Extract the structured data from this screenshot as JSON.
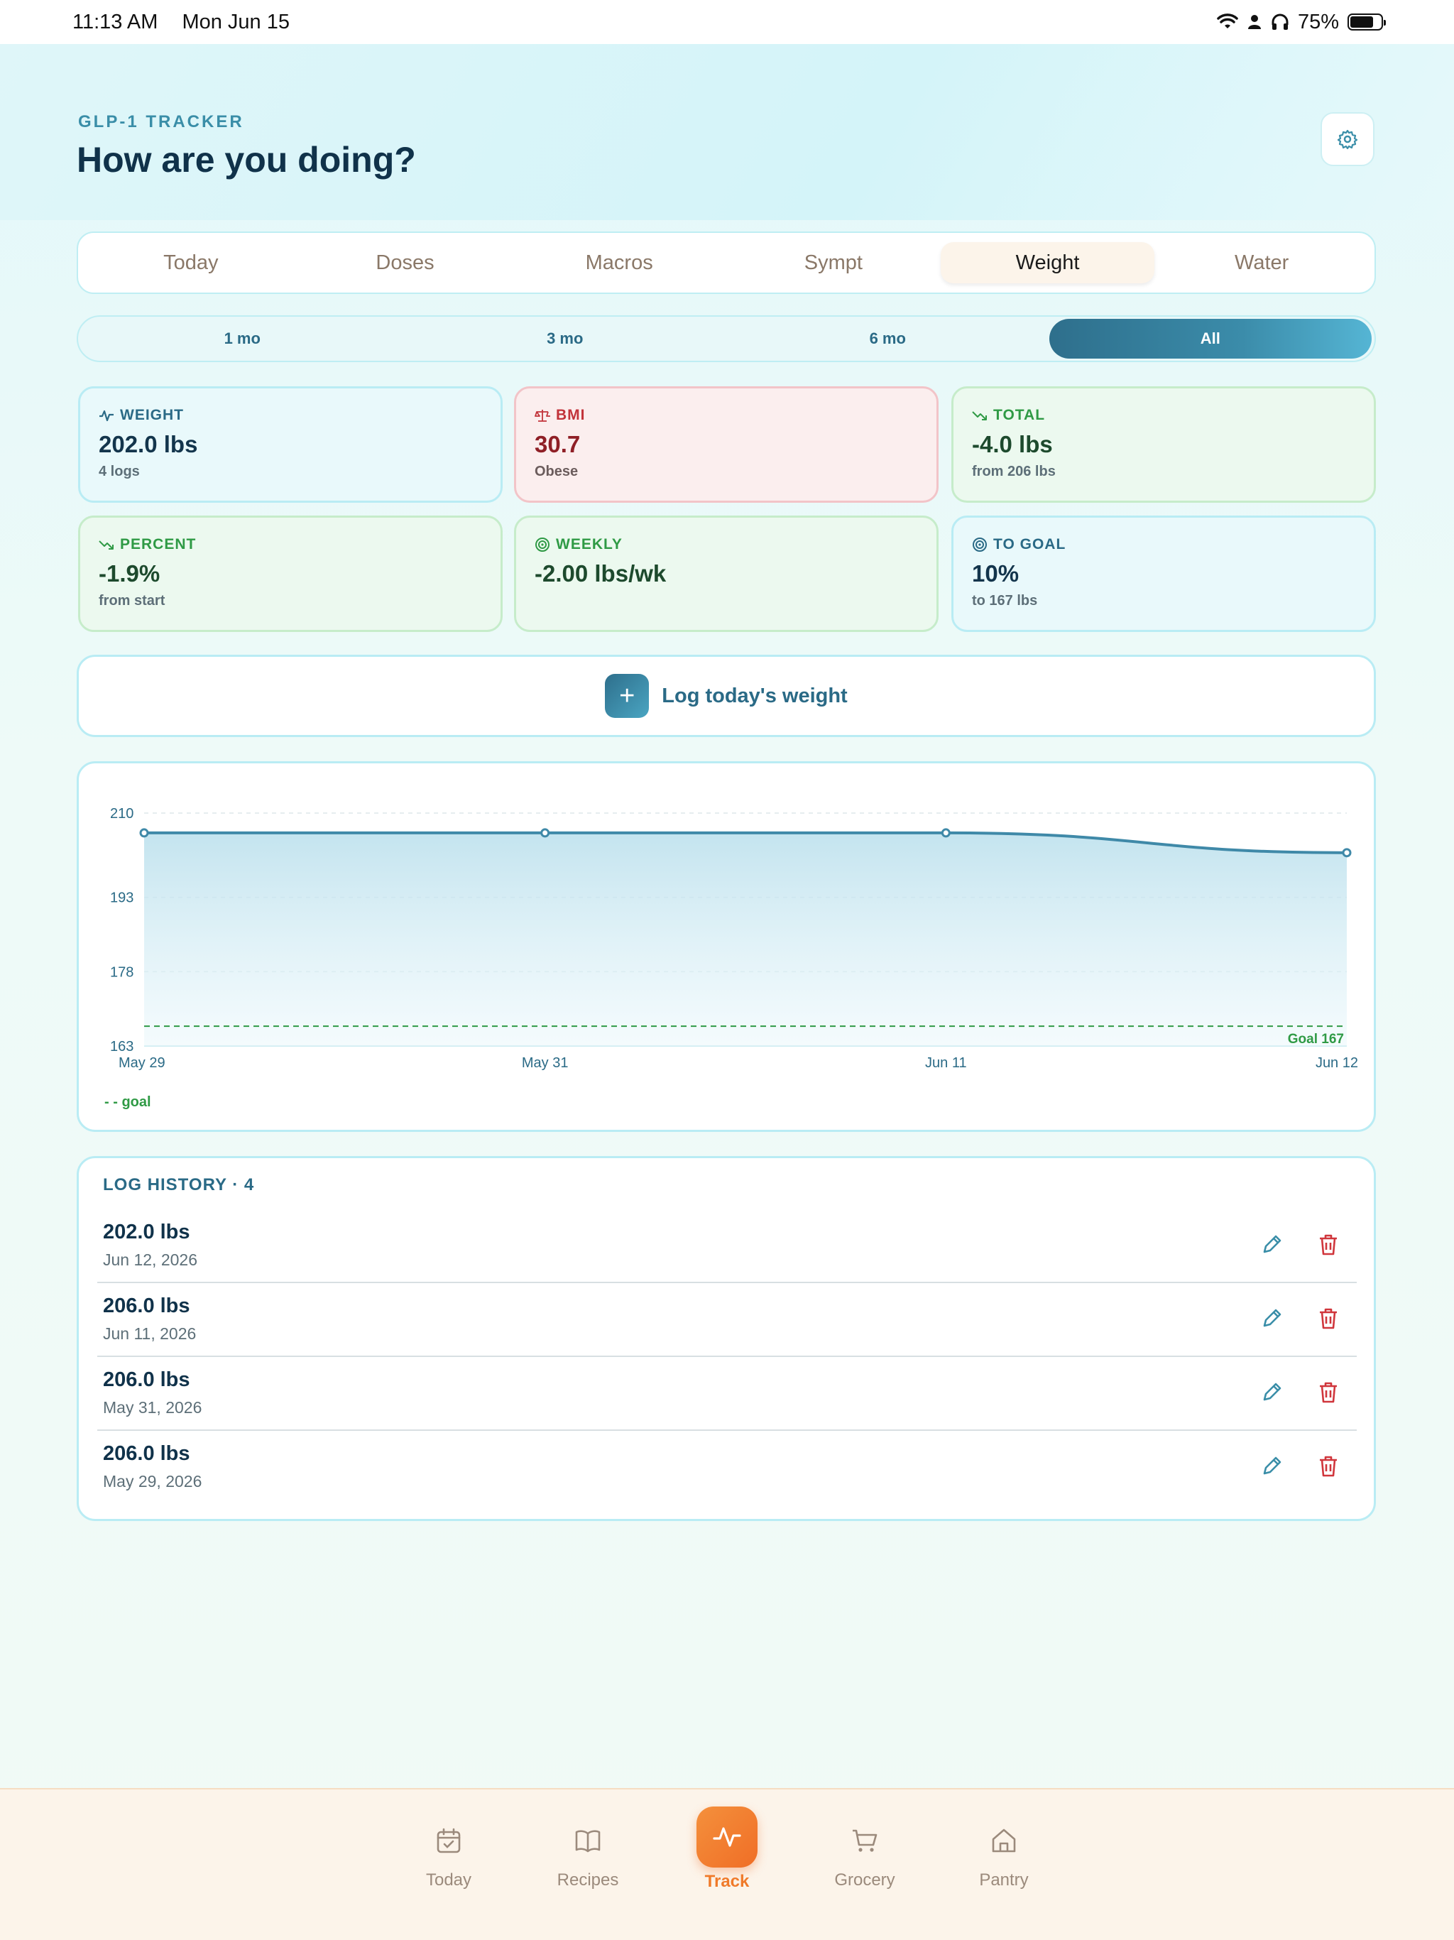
{
  "status": {
    "time": "11:13 AM",
    "date": "Mon Jun 15",
    "battery": "75%"
  },
  "header": {
    "eyebrow": "GLP-1 TRACKER",
    "title": "How are you doing?"
  },
  "tabs": [
    {
      "label": "Today",
      "active": false
    },
    {
      "label": "Doses",
      "active": false
    },
    {
      "label": "Macros",
      "active": false
    },
    {
      "label": "Sympt",
      "active": false
    },
    {
      "label": "Weight",
      "active": true
    },
    {
      "label": "Water",
      "active": false
    }
  ],
  "range": [
    {
      "label": "1 mo",
      "active": false
    },
    {
      "label": "3 mo",
      "active": false
    },
    {
      "label": "6 mo",
      "active": false
    },
    {
      "label": "All",
      "active": true
    }
  ],
  "stats": {
    "weight": {
      "label": "WEIGHT",
      "value": "202.0 lbs",
      "sub": "4 logs"
    },
    "bmi": {
      "label": "BMI",
      "value": "30.7",
      "sub": "Obese"
    },
    "total": {
      "label": "TOTAL",
      "value": "-4.0 lbs",
      "sub": "from 206 lbs"
    },
    "percent": {
      "label": "PERCENT",
      "value": "-1.9%",
      "sub": "from start"
    },
    "weekly": {
      "label": "WEEKLY",
      "value": "-2.00 lbs/wk",
      "sub": ""
    },
    "to_goal": {
      "label": "TO GOAL",
      "value": "10%",
      "sub": "to 167 lbs"
    }
  },
  "log_button": {
    "label": "Log today's weight"
  },
  "chart_data": {
    "type": "area",
    "x": [
      "May 29",
      "May 31",
      "Jun 11",
      "Jun 12"
    ],
    "values": [
      206.0,
      206.0,
      206.0,
      202.0
    ],
    "yticks": [
      210,
      193,
      178,
      163
    ],
    "ylim": [
      163,
      210
    ],
    "goal": 167,
    "goal_label": "Goal 167",
    "legend_label": "goal",
    "grid": true,
    "colors": {
      "line": "#3f89a8",
      "goal": "#2f9a45"
    }
  },
  "history": {
    "title": "LOG HISTORY · 4",
    "rows": [
      {
        "value": "202.0 lbs",
        "date": "Jun 12, 2026"
      },
      {
        "value": "206.0 lbs",
        "date": "Jun 11, 2026"
      },
      {
        "value": "206.0 lbs",
        "date": "May 31, 2026"
      },
      {
        "value": "206.0 lbs",
        "date": "May 29, 2026"
      }
    ]
  },
  "nav": [
    {
      "label": "Today",
      "icon": "calendar-icon",
      "active": false
    },
    {
      "label": "Recipes",
      "icon": "book-icon",
      "active": false
    },
    {
      "label": "Track",
      "icon": "pulse-icon",
      "active": true
    },
    {
      "label": "Grocery",
      "icon": "cart-icon",
      "active": false
    },
    {
      "label": "Pantry",
      "icon": "home-icon",
      "active": false
    }
  ],
  "colors": {
    "accent": "#2e6f8c",
    "brand_orange": "#f07a2a",
    "danger": "#c2333a",
    "success": "#2f9a45"
  }
}
